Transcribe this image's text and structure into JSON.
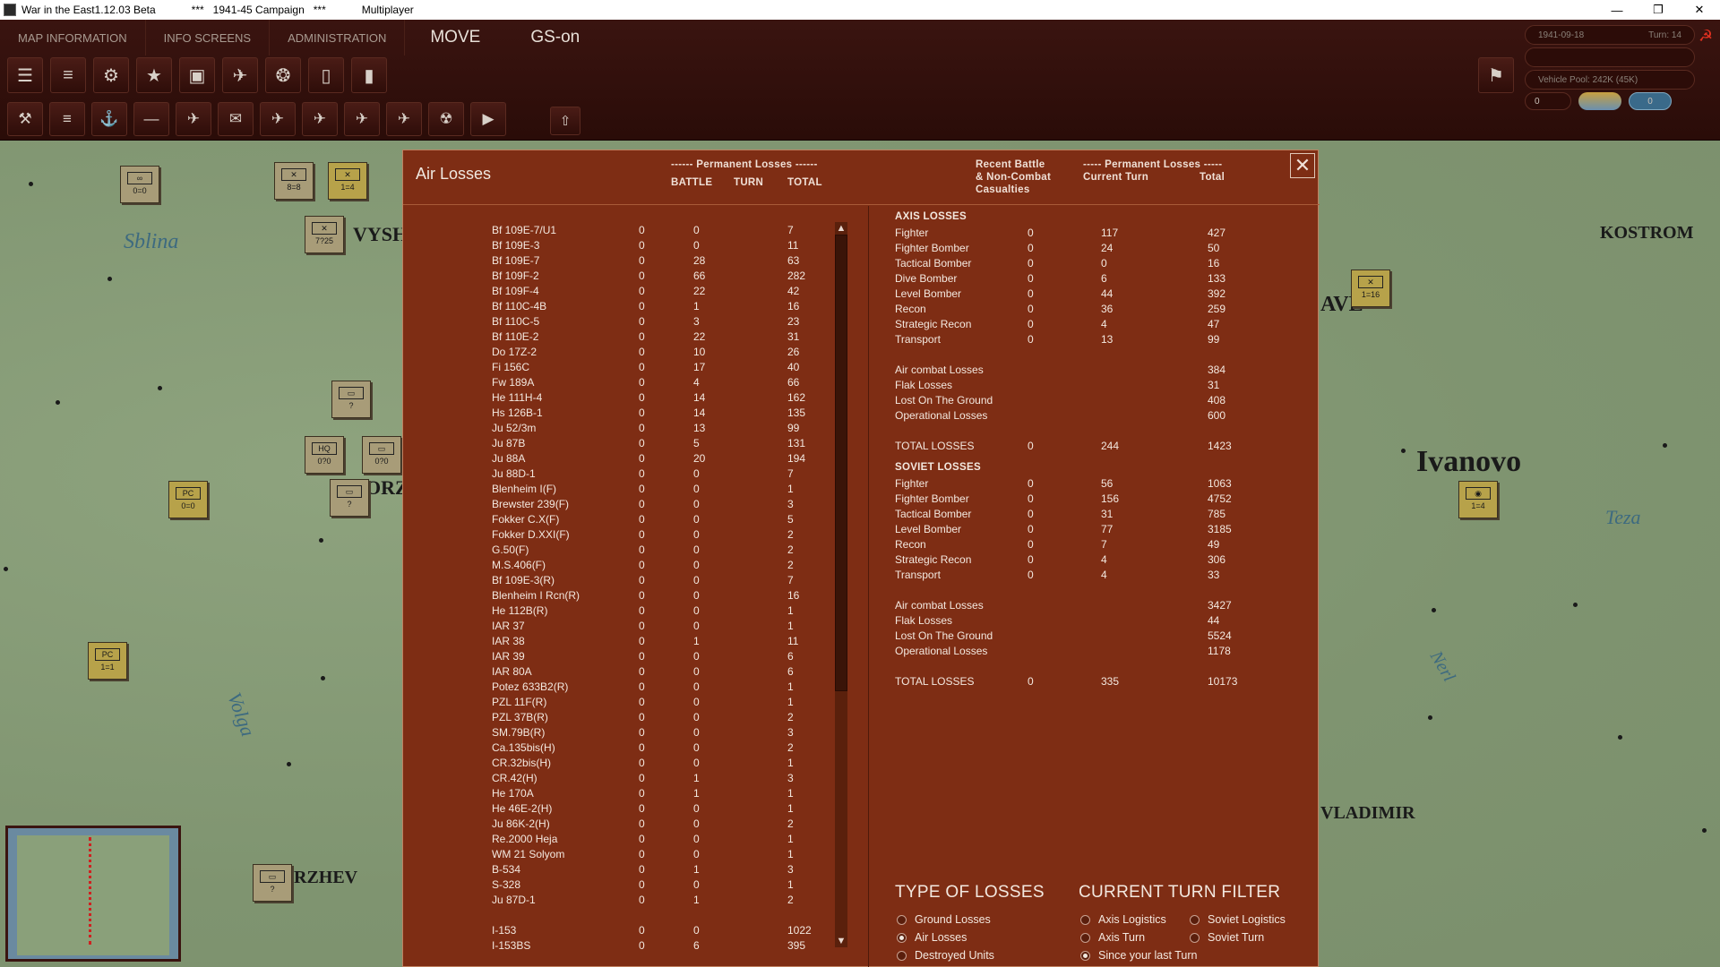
{
  "window": {
    "app_title": "War in the East1.12.03 Beta",
    "campaign": "***   1941-45 Campaign   ***",
    "mode": "Multiplayer"
  },
  "menu": [
    "MAP INFORMATION",
    "INFO SCREENS",
    "ADMINISTRATION"
  ],
  "phase": "MOVE",
  "gs_status": "GS-on",
  "toolbar_row1_icons": [
    "layers-icon",
    "units-icon",
    "gear-icon",
    "star-icon",
    "hq-icon",
    "air-icon",
    "supply-icon",
    "rail-icon",
    "fuel-icon"
  ],
  "toolbar_row2_icons": [
    {
      "name": "f1-icon",
      "key": "F1"
    },
    {
      "name": "f2-icon",
      "key": "F2"
    },
    {
      "name": "f3-icon",
      "key": "F3"
    },
    {
      "name": "f4-icon",
      "key": "F4"
    },
    {
      "name": "f5-icon",
      "key": "F5"
    },
    {
      "name": "f6-icon",
      "key": "F6"
    },
    {
      "name": "f7-icon",
      "key": "F7"
    },
    {
      "name": "f8-icon",
      "key": "F8"
    },
    {
      "name": "f9-icon",
      "key": "F9"
    },
    {
      "name": "f10-icon",
      "key": "F10"
    },
    {
      "name": "f11-icon",
      "key": "F11"
    },
    {
      "name": "f12-icon",
      "key": "F12"
    }
  ],
  "status": {
    "date": "1941-09-18",
    "turn": "Turn: 14",
    "vehicle_pool": "Vehicle Pool: 242K (45K)",
    "counter_a": "0",
    "counter_b": "0"
  },
  "map": {
    "cities": [
      "KOSTROM",
      "Ivanovo",
      "AVL",
      "VLADIMIR",
      "RZHEV",
      "VYSH",
      "ORZ"
    ],
    "rivers": [
      "Sblina",
      "Volga",
      "Teza",
      "Nerl"
    ],
    "counters": [
      "0=0",
      "8=8",
      "1=4",
      "7?25",
      "?",
      "0?0",
      "0?0",
      "0=0",
      "?",
      "1=1",
      "?",
      "1=16",
      "1=4"
    ],
    "counter_types": [
      "HQ",
      "PC",
      "PC"
    ],
    "colors": {
      "axis_counter": "#a89c78",
      "soviet_counter": "#b7a24a"
    }
  },
  "dialog": {
    "title": "Air Losses",
    "left_header_group": "------ Permanent Losses ------",
    "left_cols": [
      "BATTLE",
      "TURN",
      "TOTAL"
    ],
    "right_header_recent": [
      "Recent Battle",
      "& Non-Combat",
      "Casualties"
    ],
    "right_header_group": "----- Permanent Losses -----",
    "right_cols": [
      "Current Turn",
      "Total"
    ],
    "left_rows": [
      [
        "Bf 109E-7/U1",
        "0",
        "0",
        "7"
      ],
      [
        "Bf 109E-3",
        "0",
        "0",
        "11"
      ],
      [
        "Bf 109E-7",
        "0",
        "28",
        "63"
      ],
      [
        "Bf 109F-2",
        "0",
        "66",
        "282"
      ],
      [
        "Bf 109F-4",
        "0",
        "22",
        "42"
      ],
      [
        "Bf 110C-4B",
        "0",
        "1",
        "16"
      ],
      [
        "Bf 110C-5",
        "0",
        "3",
        "23"
      ],
      [
        "Bf 110E-2",
        "0",
        "22",
        "31"
      ],
      [
        "Do 17Z-2",
        "0",
        "10",
        "26"
      ],
      [
        "Fi 156C",
        "0",
        "17",
        "40"
      ],
      [
        "Fw 189A",
        "0",
        "4",
        "66"
      ],
      [
        "He 111H-4",
        "0",
        "14",
        "162"
      ],
      [
        "Hs 126B-1",
        "0",
        "14",
        "135"
      ],
      [
        "Ju 52/3m",
        "0",
        "13",
        "99"
      ],
      [
        "Ju 87B",
        "0",
        "5",
        "131"
      ],
      [
        "Ju 88A",
        "0",
        "20",
        "194"
      ],
      [
        "Ju 88D-1",
        "0",
        "0",
        "7"
      ],
      [
        "Blenheim I(F)",
        "0",
        "0",
        "1"
      ],
      [
        "Brewster 239(F)",
        "0",
        "0",
        "3"
      ],
      [
        "Fokker C.X(F)",
        "0",
        "0",
        "5"
      ],
      [
        "Fokker D.XXI(F)",
        "0",
        "0",
        "2"
      ],
      [
        "G.50(F)",
        "0",
        "0",
        "2"
      ],
      [
        "M.S.406(F)",
        "0",
        "0",
        "2"
      ],
      [
        "Bf 109E-3(R)",
        "0",
        "0",
        "7"
      ],
      [
        "Blenheim I Rcn(R)",
        "0",
        "0",
        "16"
      ],
      [
        "He 112B(R)",
        "0",
        "0",
        "1"
      ],
      [
        "IAR 37",
        "0",
        "0",
        "1"
      ],
      [
        "IAR 38",
        "0",
        "1",
        "11"
      ],
      [
        "IAR 39",
        "0",
        "0",
        "6"
      ],
      [
        "IAR 80A",
        "0",
        "0",
        "6"
      ],
      [
        "Potez 633B2(R)",
        "0",
        "0",
        "1"
      ],
      [
        "PZL 11F(R)",
        "0",
        "0",
        "1"
      ],
      [
        "PZL 37B(R)",
        "0",
        "0",
        "2"
      ],
      [
        "SM.79B(R)",
        "0",
        "0",
        "3"
      ],
      [
        "Ca.135bis(H)",
        "0",
        "0",
        "2"
      ],
      [
        "CR.32bis(H)",
        "0",
        "0",
        "1"
      ],
      [
        "CR.42(H)",
        "0",
        "1",
        "3"
      ],
      [
        "He 170A",
        "0",
        "1",
        "1"
      ],
      [
        "He 46E-2(H)",
        "0",
        "0",
        "1"
      ],
      [
        "Ju 86K-2(H)",
        "0",
        "0",
        "2"
      ],
      [
        "Re.2000 Heja",
        "0",
        "0",
        "1"
      ],
      [
        "WM 21 Solyom",
        "0",
        "0",
        "1"
      ],
      [
        "B-534",
        "0",
        "1",
        "3"
      ],
      [
        "S-328",
        "0",
        "0",
        "1"
      ],
      [
        "Ju 87D-1",
        "0",
        "1",
        "2"
      ],
      [
        "",
        "",
        "",
        ""
      ],
      [
        "I-153",
        "0",
        "0",
        "1022"
      ],
      [
        "I-153BS",
        "0",
        "6",
        "395"
      ]
    ],
    "axis": {
      "title": "AXIS LOSSES",
      "types": [
        [
          "Fighter",
          "0",
          "117",
          "427"
        ],
        [
          "Fighter Bomber",
          "0",
          "24",
          "50"
        ],
        [
          "Tactical Bomber",
          "0",
          "0",
          "16"
        ],
        [
          "Dive Bomber",
          "0",
          "6",
          "133"
        ],
        [
          "Level Bomber",
          "0",
          "44",
          "392"
        ],
        [
          "Recon",
          "0",
          "36",
          "259"
        ],
        [
          "Strategic Recon",
          "0",
          "4",
          "47"
        ],
        [
          "Transport",
          "0",
          "13",
          "99"
        ]
      ],
      "causes": [
        [
          "Air combat Losses",
          "384"
        ],
        [
          "Flak Losses",
          "31"
        ],
        [
          "Lost On The Ground",
          "408"
        ],
        [
          "Operational Losses",
          "600"
        ]
      ],
      "total": [
        "TOTAL LOSSES",
        "0",
        "244",
        "1423"
      ]
    },
    "soviet": {
      "title": "SOVIET LOSSES",
      "types": [
        [
          "Fighter",
          "0",
          "56",
          "1063"
        ],
        [
          "Fighter Bomber",
          "0",
          "156",
          "4752"
        ],
        [
          "Tactical Bomber",
          "0",
          "31",
          "785"
        ],
        [
          "Level Bomber",
          "0",
          "77",
          "3185"
        ],
        [
          "Recon",
          "0",
          "7",
          "49"
        ],
        [
          "Strategic Recon",
          "0",
          "4",
          "306"
        ],
        [
          "Transport",
          "0",
          "4",
          "33"
        ]
      ],
      "causes": [
        [
          "Air combat Losses",
          "3427"
        ],
        [
          "Flak Losses",
          "44"
        ],
        [
          "Lost On The Ground",
          "5524"
        ],
        [
          "Operational Losses",
          "1178"
        ]
      ],
      "total": [
        "TOTAL LOSSES",
        "0",
        "335",
        "10173"
      ]
    },
    "type_of_losses": {
      "title": "TYPE OF LOSSES",
      "options": [
        "Ground Losses",
        "Air Losses",
        "Destroyed Units"
      ],
      "selected": 1
    },
    "turn_filter": {
      "title": "CURRENT TURN FILTER",
      "options": [
        "Axis Logistics",
        "Soviet Logistics",
        "Axis Turn",
        "Soviet Turn",
        "Since your last Turn"
      ],
      "selected": 4
    },
    "colors": {
      "background": "#7e2d14",
      "text": "#f3e8df"
    }
  }
}
